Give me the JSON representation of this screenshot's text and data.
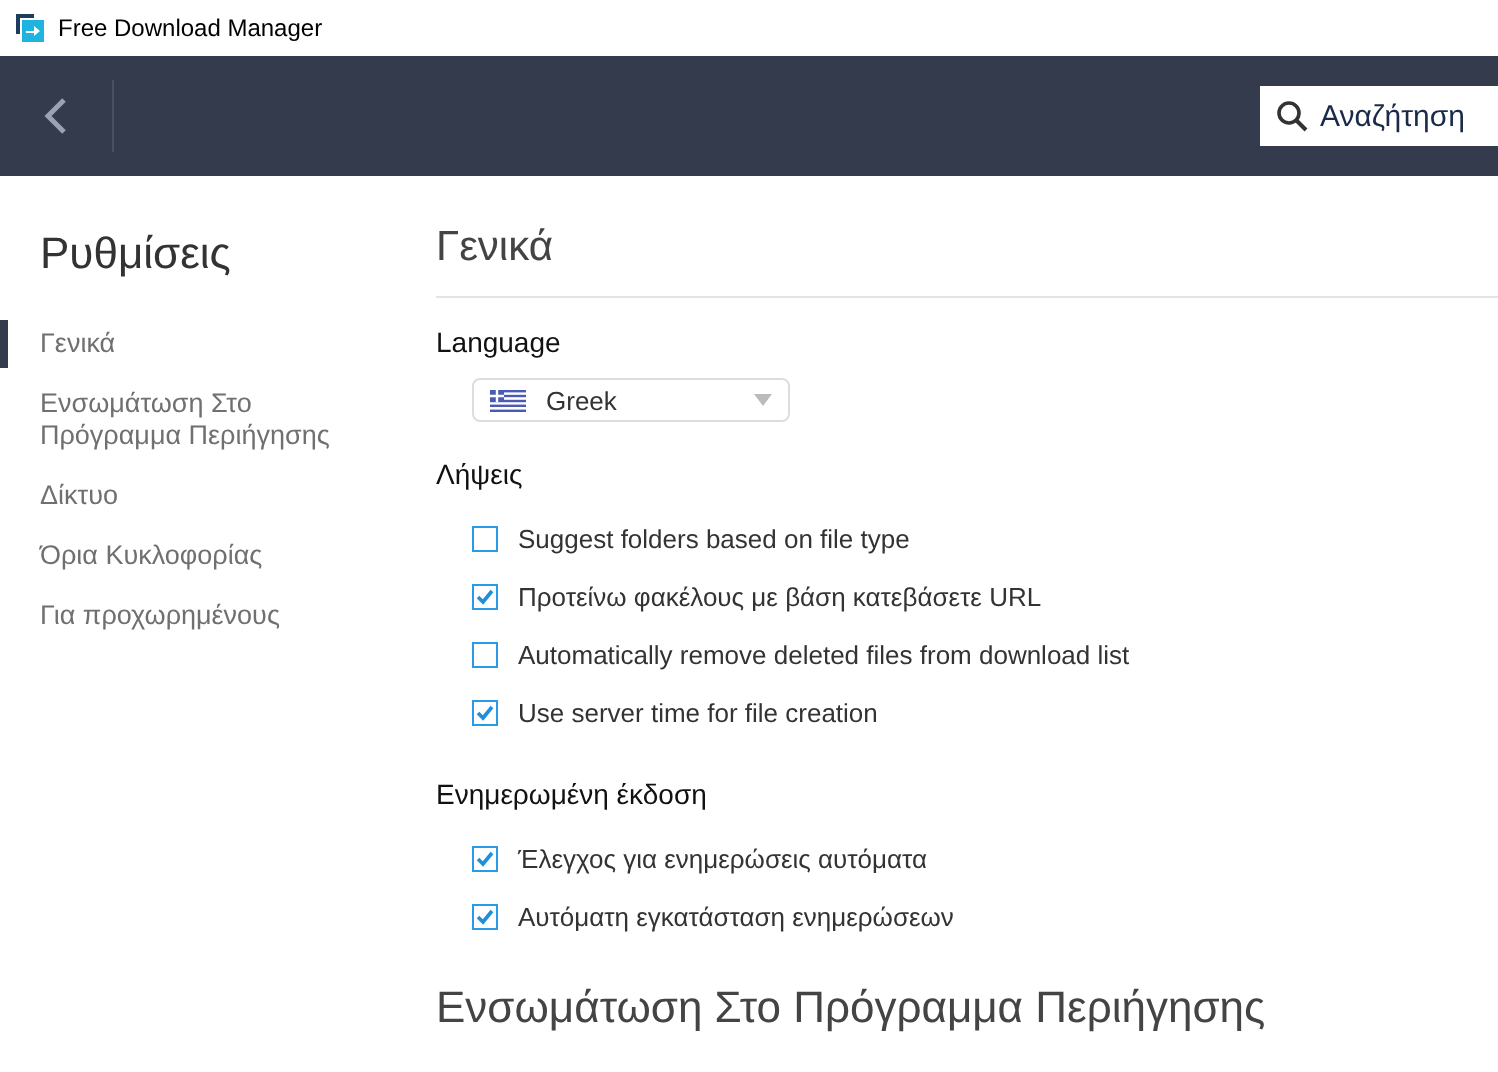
{
  "window": {
    "title": "Free Download Manager"
  },
  "toolbar": {
    "search": {
      "placeholder": "Αναζήτηση"
    }
  },
  "sidebar": {
    "title": "Ρυθμίσεις",
    "items": [
      {
        "label": "Γενικά",
        "selected": true
      },
      {
        "label": "Ενσωμάτωση Στο Πρόγραμμα Περιήγησης",
        "selected": false
      },
      {
        "label": "Δίκτυο",
        "selected": false
      },
      {
        "label": "Όρια Κυκλοφορίας",
        "selected": false
      },
      {
        "label": "Για προχωρημένους",
        "selected": false
      }
    ]
  },
  "content": {
    "heading": "Γενικά",
    "language": {
      "label": "Language",
      "value": "Greek"
    },
    "groups": [
      {
        "title": "Λήψεις",
        "options": [
          {
            "label": "Suggest folders based on file type",
            "checked": false
          },
          {
            "label": "Προτείνω φακέλους με βάση κατεβάσετε URL",
            "checked": true
          },
          {
            "label": "Automatically remove deleted files from download list",
            "checked": false
          },
          {
            "label": "Use server time for file creation",
            "checked": true
          }
        ]
      },
      {
        "title": "Ενημερωμένη έκδοση",
        "options": [
          {
            "label": "Έλεγχος για ενημερώσεις αυτόματα",
            "checked": true
          },
          {
            "label": "Αυτόματη εγκατάσταση ενημερώσεων",
            "checked": true
          }
        ]
      }
    ],
    "next_heading": "Ενσωμάτωση Στο Πρόγραμμα Περιήγησης"
  }
}
